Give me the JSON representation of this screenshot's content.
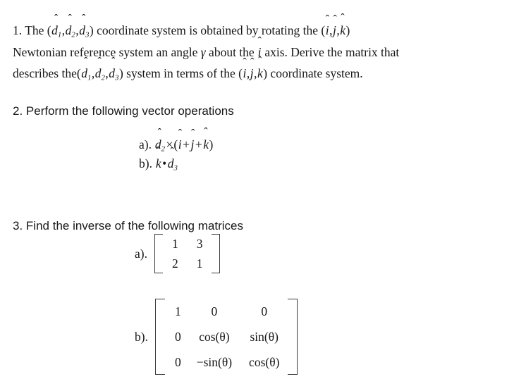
{
  "document": {
    "background_color": "#ffffff",
    "text_color": "#171717",
    "questions": [
      {
        "number": "1.",
        "lines": [
          "The (d̂1,d̂2,d̂3) coordinate system is obtained by rotating the (î, ĵ, k̂)",
          "Newtonian reference system an angle γ about the î axis.  Derive the matrix that",
          "describes the (d̂1,d̂2,d̂3) system in terms of the (î, ĵ, k̂) coordinate system."
        ]
      },
      {
        "number": "2.",
        "prompt": "Perform the following vector operations",
        "parts": [
          {
            "label": "a).",
            "expression": "d̂2 × (î + ĵ + k̂)"
          },
          {
            "label": "b).",
            "expression": "k̂ • d̂3"
          }
        ]
      },
      {
        "number": "3.",
        "prompt": "Find the inverse of the following matrices",
        "parts": [
          {
            "label": "a).",
            "matrix": [
              [
                "1",
                "3"
              ],
              [
                "2",
                "1"
              ]
            ]
          },
          {
            "label": "b).",
            "matrix": [
              [
                "1",
                "0",
                "0"
              ],
              [
                "0",
                "cos(θ)",
                "sin(θ)"
              ],
              [
                "0",
                "−sin(θ)",
                "cos(θ)"
              ]
            ]
          }
        ]
      }
    ],
    "text_tokens": {
      "q1_num": "1.",
      "q1_the": "The",
      "q1_coordinate_system": "coordinate system is obtained by rotating the",
      "q1_newtonian": "Newtonian reference system an angle",
      "q1_about_the": "about the",
      "q1_axis_derive": "axis.  Derive the matrix that",
      "q1_describes_the": "describes the",
      "q1_system_in_terms": "system in terms of the",
      "q1_coord_sys_end": "coordinate system.",
      "q2_num": "2.",
      "q2_prompt": "Perform the following vector operations",
      "q2a_label": "a).",
      "q2b_label": "b).",
      "q3_num": "3.",
      "q3_prompt": "Find the inverse of the following matrices",
      "q3a_label": "a).",
      "q3b_label": "b).",
      "gamma": "γ",
      "theta": "θ",
      "cross": "×",
      "dot": "•",
      "plus": "+",
      "minus": "−",
      "comma": ",",
      "lparen": "(",
      "rparen": ")",
      "var_d": "d",
      "var_i": "i",
      "var_j": "j",
      "var_k": "k",
      "hat": "̂",
      "hat_glyph": "ˆ",
      "sub1": "1",
      "sub2": "2",
      "sub3": "3",
      "cos": "cos",
      "sin": "sin",
      "zero": "0",
      "one": "1",
      "two": "2",
      "three": "3"
    }
  }
}
